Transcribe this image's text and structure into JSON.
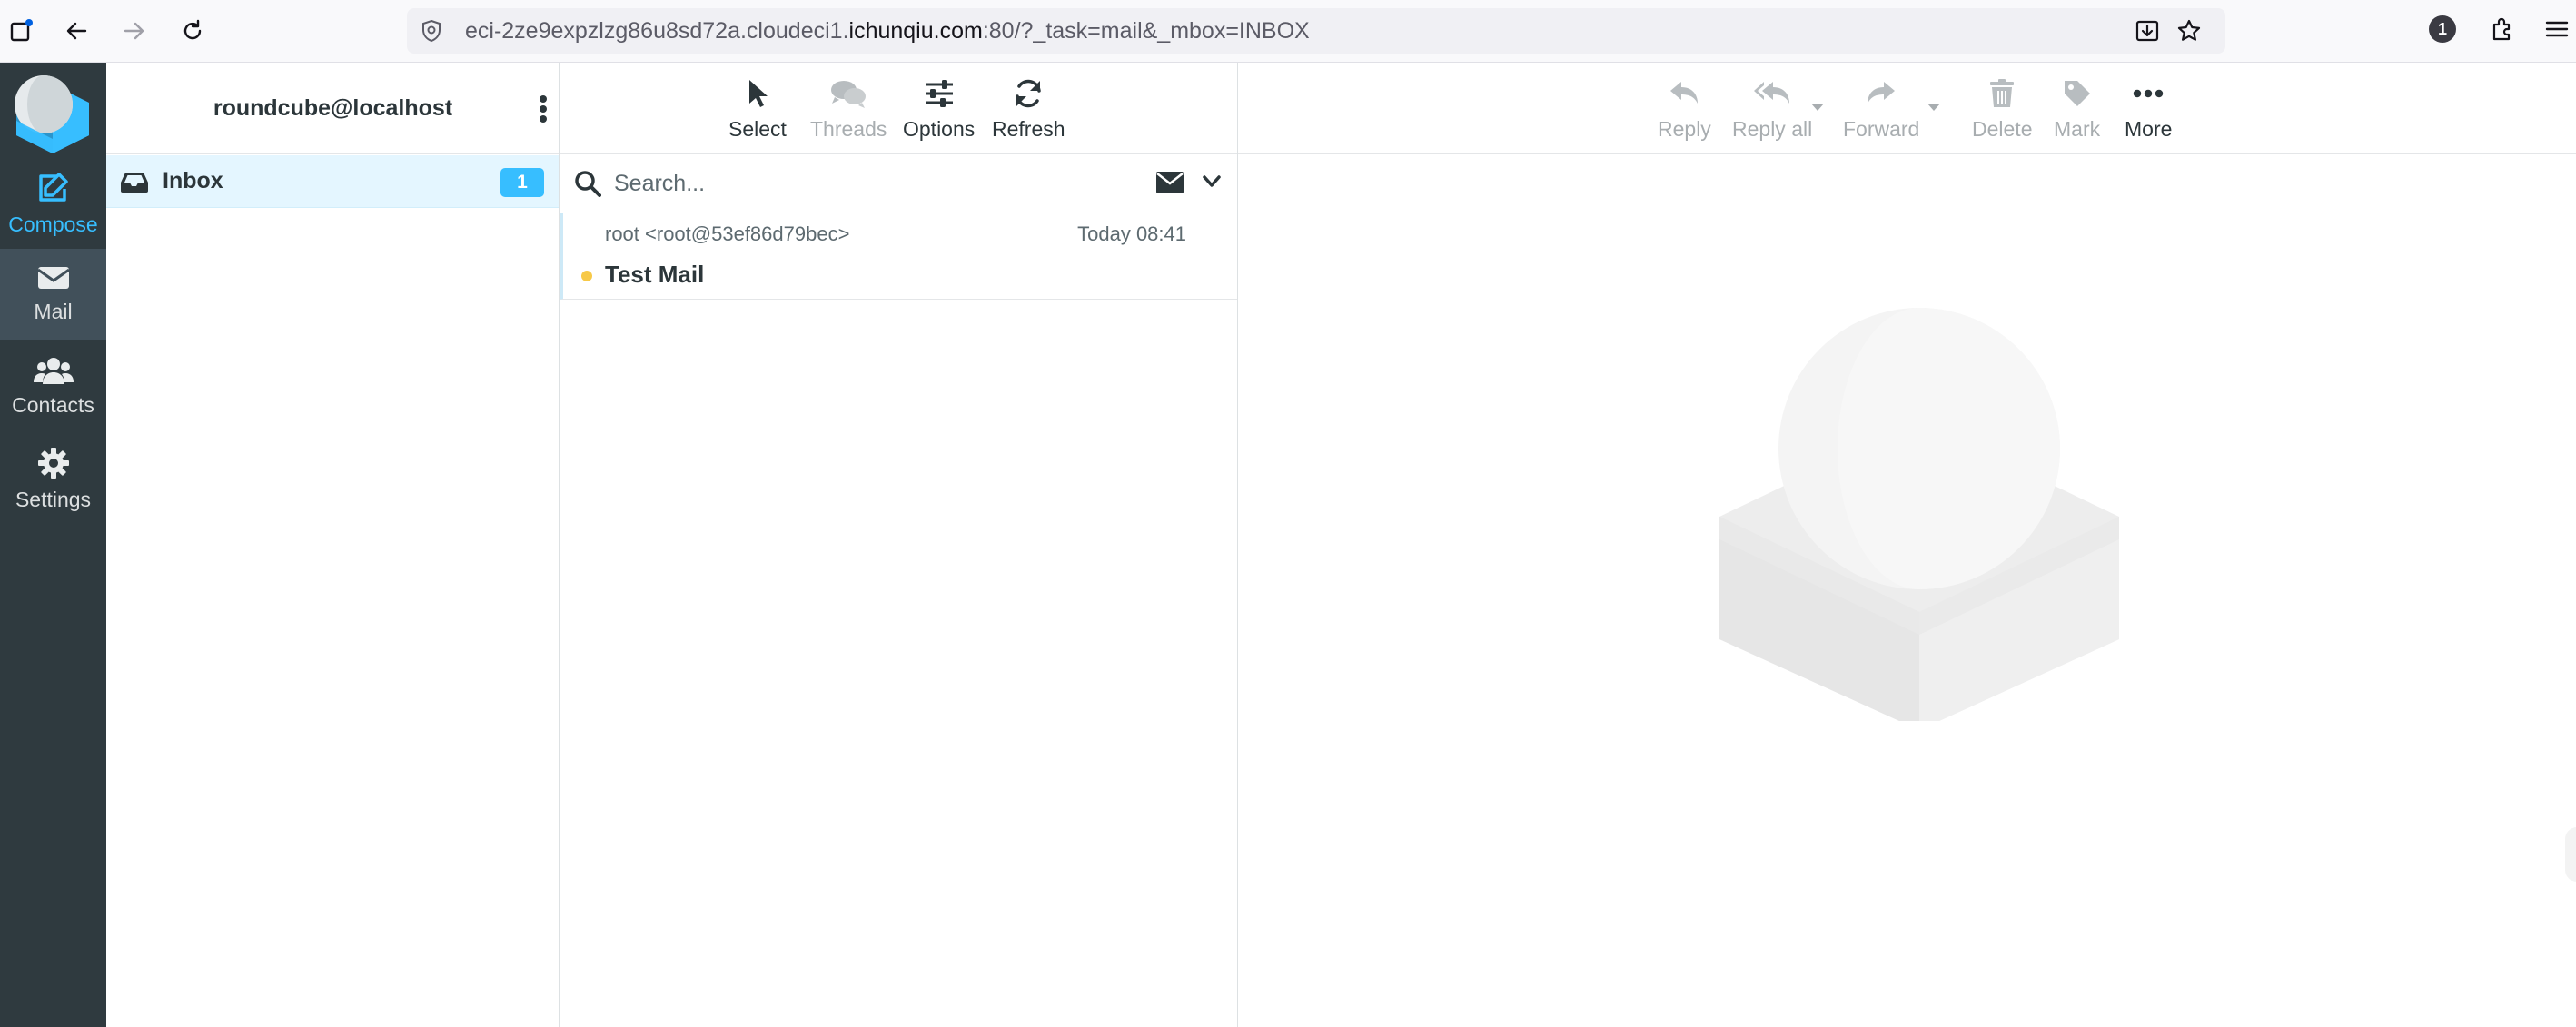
{
  "browser": {
    "url_prefix": "eci-2ze9expzlzg86u8sd72a.cloudeci1.",
    "url_domain": "ichunqiu.com",
    "url_suffix": ":80/?_task=mail&_mbox=INBOX",
    "notification_count": "1"
  },
  "taskmenu": {
    "compose": "Compose",
    "mail": "Mail",
    "contacts": "Contacts",
    "settings": "Settings"
  },
  "folders": {
    "username": "roundcube@localhost",
    "items": [
      {
        "name": "Inbox",
        "unread": "1"
      }
    ]
  },
  "list_toolbar": {
    "select": "Select",
    "threads": "Threads",
    "options": "Options",
    "refresh": "Refresh"
  },
  "search": {
    "placeholder": "Search..."
  },
  "messages": [
    {
      "from": "root <root@53ef86d79bec>",
      "date": "Today 08:41",
      "subject": "Test Mail"
    }
  ],
  "message_toolbar": {
    "reply": "Reply",
    "reply_all": "Reply all",
    "forward": "Forward",
    "delete": "Delete",
    "mark": "Mark",
    "more": "More"
  },
  "colors": {
    "accent": "#37beff",
    "taskmenu_bg": "#2f3a3f",
    "selected_folder_bg": "#e4f6ff",
    "unread_dot": "#f7c948"
  }
}
